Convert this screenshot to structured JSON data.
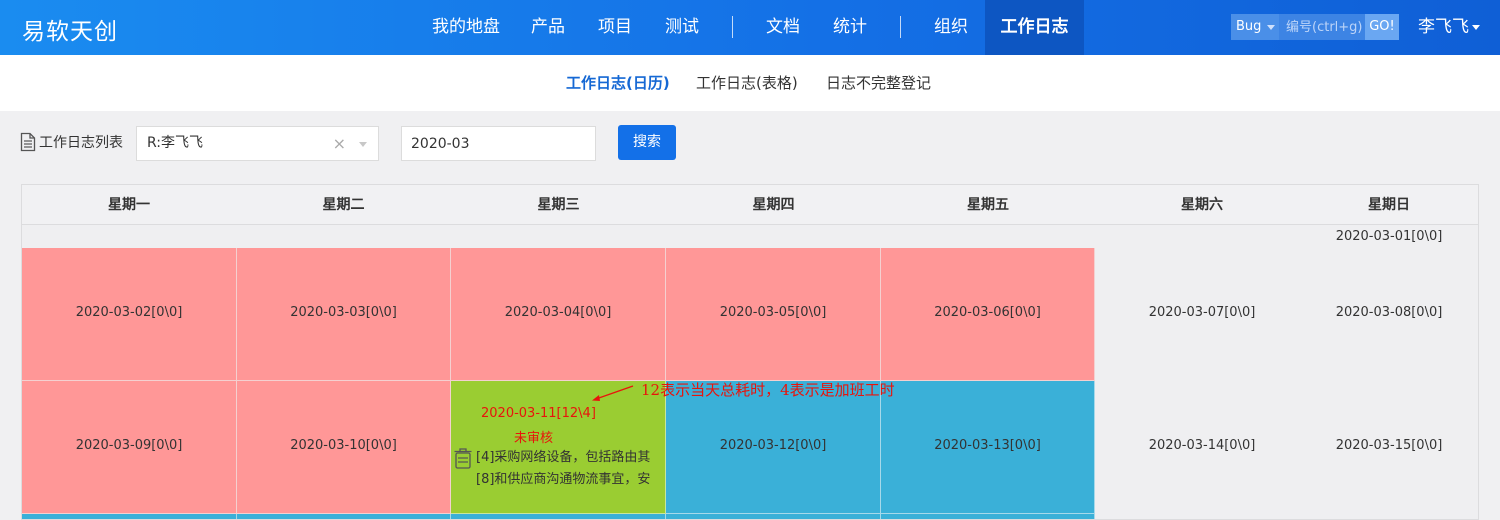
{
  "navbar": {
    "brand": "易软天创",
    "items": [
      "我的地盘",
      "产品",
      "项目",
      "测试",
      "文档",
      "统计",
      "组织",
      "工作日志"
    ],
    "active": "工作日志",
    "search_type": "Bug",
    "search_placeholder": "编号(ctrl+g)",
    "go_label": "GO!",
    "user": "李飞飞"
  },
  "subnav": {
    "items": [
      "工作日志(日历)",
      "工作日志(表格)",
      "日志不完整登记"
    ],
    "active": "工作日志(日历)"
  },
  "filter": {
    "label": "工作日志列表",
    "user_value": "R:李飞飞",
    "month_value": "2020-03",
    "search_button": "搜索"
  },
  "calendar": {
    "weekdays": [
      "星期一",
      "星期二",
      "星期三",
      "星期四",
      "星期五",
      "星期六",
      "星期日"
    ],
    "row0": [
      "2020-03-01[0\\0]"
    ],
    "row1": [
      "2020-03-02[0\\0]",
      "2020-03-03[0\\0]",
      "2020-03-04[0\\0]",
      "2020-03-05[0\\0]",
      "2020-03-06[0\\0]",
      "2020-03-07[0\\0]",
      "2020-03-08[0\\0]"
    ],
    "row2": [
      "2020-03-09[0\\0]",
      "2020-03-10[0\\0]",
      "2020-03-11[12\\4]",
      "2020-03-12[0\\0]",
      "2020-03-13[0\\0]",
      "2020-03-14[0\\0]",
      "2020-03-15[0\\0]"
    ],
    "highlight": {
      "date": "2020-03-11[12\\4]",
      "status": "未审核",
      "entries": [
        "[4]采购网络设备，包括路由其",
        "[8]和供应商沟通物流事宜，安"
      ]
    },
    "colors": {
      "red": "#ff9797",
      "blue": "#3ab0d8",
      "green": "#9acd32"
    }
  },
  "annotation": "12表示当天总耗时，4表示是加班工时"
}
